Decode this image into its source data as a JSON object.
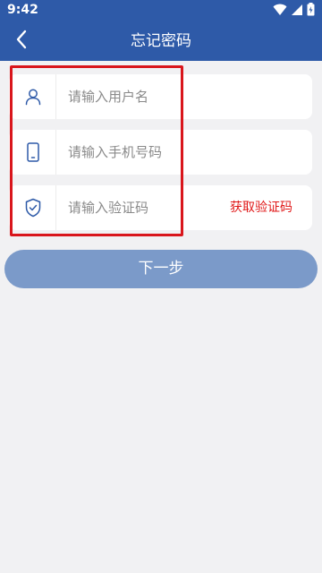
{
  "status_bar": {
    "time": "9:42"
  },
  "header": {
    "title": "忘记密码",
    "back_icon": "chevron-left-icon"
  },
  "form": {
    "username": {
      "icon": "user-icon",
      "placeholder": "请输入用户名",
      "value": ""
    },
    "phone": {
      "icon": "phone-icon",
      "placeholder": "请输入手机号码",
      "value": ""
    },
    "code": {
      "icon": "shield-check-icon",
      "placeholder": "请输入验证码",
      "value": "",
      "get_code_label": "获取验证码"
    }
  },
  "actions": {
    "next_label": "下一步"
  },
  "colors": {
    "primary": "#2e5aa8",
    "button_disabled": "#7b9ac9",
    "accent_red": "#e01818",
    "highlight": "#d9161c",
    "background": "#f1f1f3"
  }
}
